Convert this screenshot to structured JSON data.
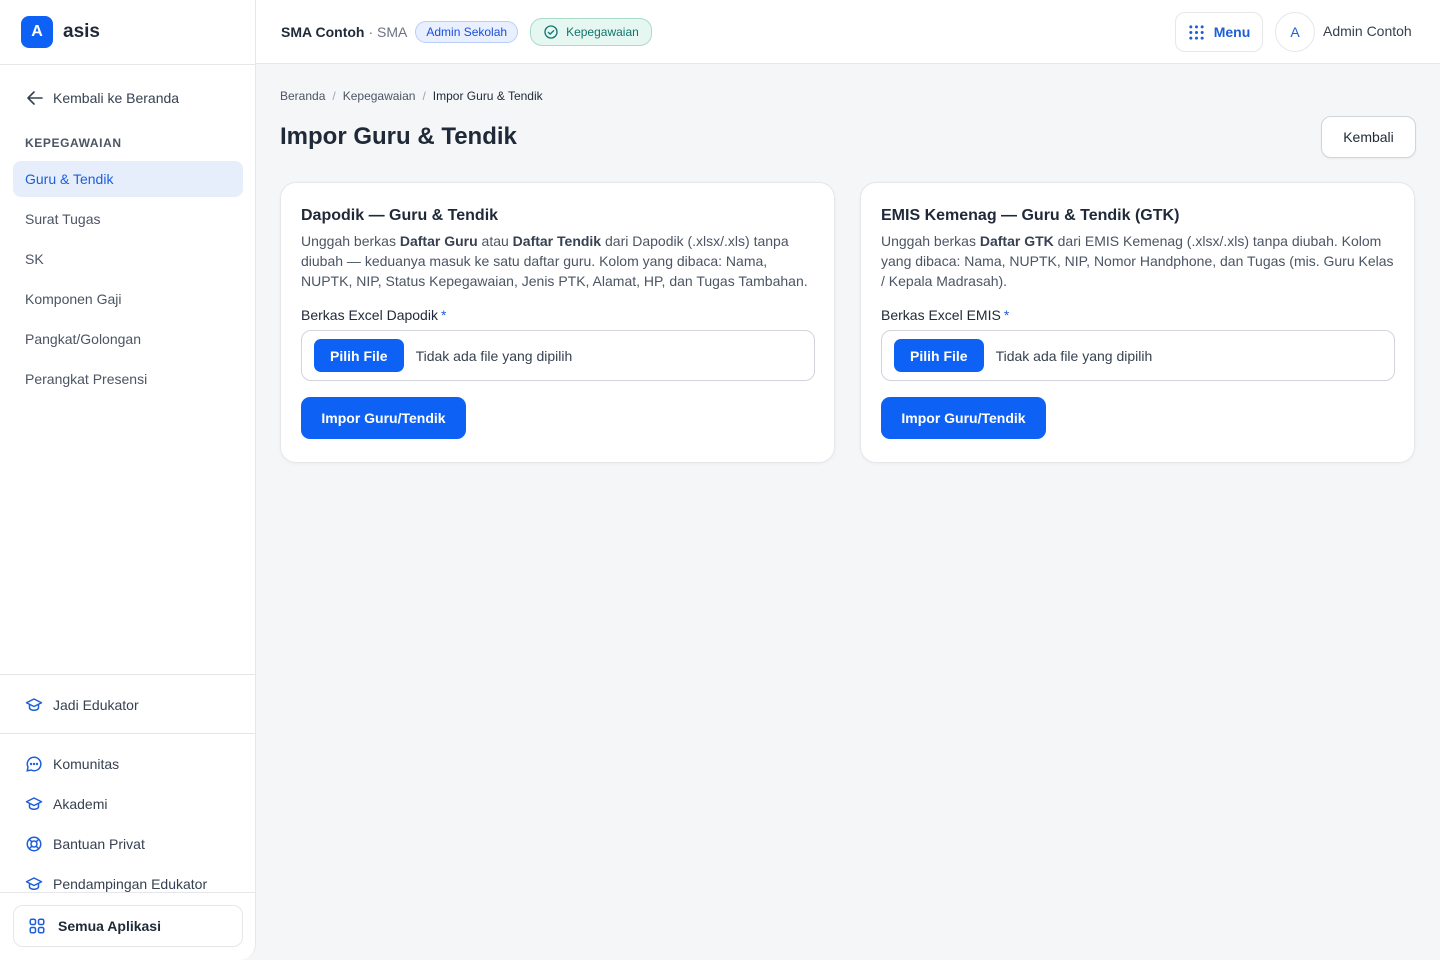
{
  "brand": {
    "logo_letter": "A",
    "name": "asis"
  },
  "sidebar": {
    "back_label": "Kembali ke Beranda",
    "section_title": "KEPEGAWAIAN",
    "items": [
      {
        "label": "Guru & Tendik",
        "active": true
      },
      {
        "label": "Surat Tugas"
      },
      {
        "label": "SK"
      },
      {
        "label": "Komponen Gaji"
      },
      {
        "label": "Pangkat/Golongan"
      },
      {
        "label": "Perangkat Presensi"
      }
    ],
    "educator_link": "Jadi Edukator",
    "links": [
      {
        "label": "Komunitas",
        "icon": "chat-icon"
      },
      {
        "label": "Akademi",
        "icon": "graduation-cap-icon"
      },
      {
        "label": "Bantuan Privat",
        "icon": "lifebuoy-icon"
      },
      {
        "label": "Pendampingan Edukator",
        "icon": "graduation-cap-icon"
      }
    ],
    "all_apps": "Semua Aplikasi"
  },
  "topbar": {
    "school_name": "SMA Contoh",
    "school_type": "· SMA",
    "role_badge": "Admin Sekolah",
    "module_badge": "Kepegawaian",
    "menu_label": "Menu",
    "avatar_letter": "A",
    "user_name": "Admin Contoh"
  },
  "breadcrumb": [
    "Beranda",
    "Kepegawaian",
    "Impor Guru & Tendik"
  ],
  "page": {
    "title": "Impor Guru & Tendik",
    "back_button": "Kembali"
  },
  "cards": [
    {
      "title": "Dapodik — Guru & Tendik",
      "desc_parts": {
        "p1": "Unggah berkas ",
        "b1": "Daftar Guru",
        "p2": " atau ",
        "b2": "Daftar Tendik",
        "p3": " dari Dapodik (.xlsx/.xls) tanpa diubah — keduanya masuk ke satu daftar guru. Kolom yang dibaca: Nama, NUPTK, NIP, Status Kepegawaian, Jenis PTK, Alamat, HP, dan Tugas Tambahan."
      },
      "field_label": "Berkas Excel Dapodik",
      "required_mark": "*",
      "file_button": "Pilih File",
      "file_status": "Tidak ada file yang dipilih",
      "submit": "Impor Guru/Tendik"
    },
    {
      "title": "EMIS Kemenag — Guru & Tendik (GTK)",
      "desc_parts": {
        "p1": "Unggah berkas ",
        "b1": "Daftar GTK",
        "p2": " dari EMIS Kemenag (.xlsx/.xls) tanpa diubah. Kolom yang dibaca: Nama, NUPTK, NIP, Nomor Handphone, dan Tugas (mis. Guru Kelas / Kepala Madrasah)."
      },
      "field_label": "Berkas Excel EMIS",
      "required_mark": "*",
      "file_button": "Pilih File",
      "file_status": "Tidak ada file yang dipilih",
      "submit": "Impor Guru/Tendik"
    }
  ],
  "colors": {
    "primary": "#0d62f5",
    "active_nav_bg": "#e6eefc",
    "module_badge_text": "#0f766e"
  }
}
